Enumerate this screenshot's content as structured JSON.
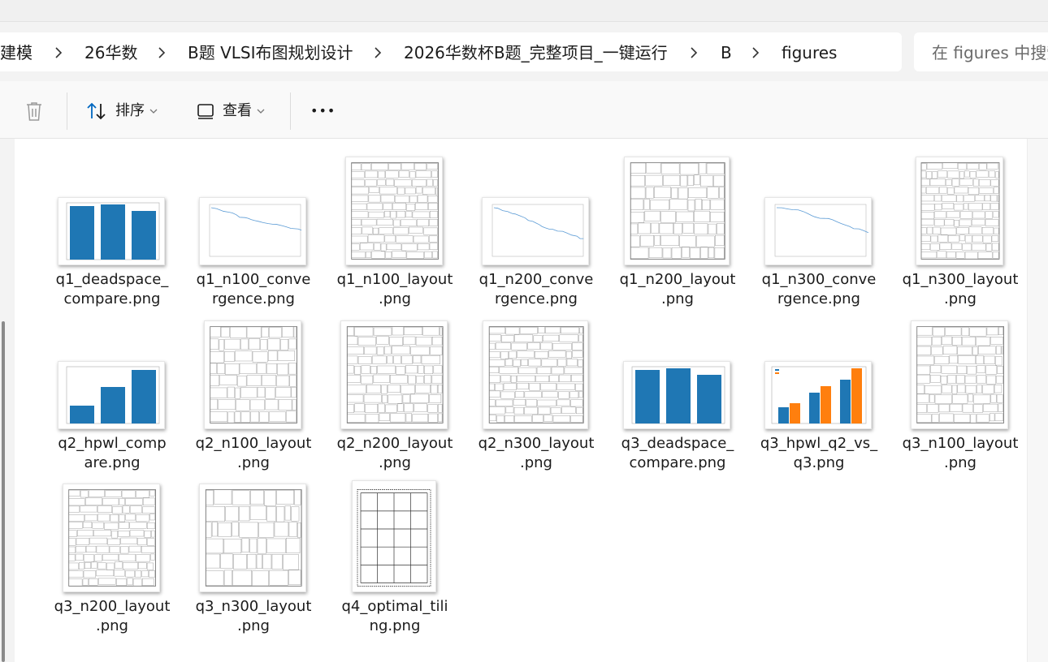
{
  "breadcrumb": [
    "建模",
    "26华数",
    "B题 VLSI布图规划设计",
    "2026华数杯B题_完整项目_一键运行",
    "B",
    "figures"
  ],
  "search": {
    "placeholder": "在 figures 中搜索"
  },
  "toolbar": {
    "delete_icon": "trash-icon",
    "sort_label": "排序",
    "view_label": "查看",
    "more_label": "•••"
  },
  "files": [
    {
      "line1": "q1_deadspace_",
      "line2": "compare.png",
      "kind": "bar3"
    },
    {
      "line1": "q1_n100_conve",
      "line2": "rgence.png",
      "kind": "conv"
    },
    {
      "line1": "q1_n100_layout",
      "line2": ".png",
      "kind": "layout"
    },
    {
      "line1": "q1_n200_conve",
      "line2": "rgence.png",
      "kind": "conv"
    },
    {
      "line1": "q1_n200_layout",
      "line2": ".png",
      "kind": "layout"
    },
    {
      "line1": "q1_n300_conve",
      "line2": "rgence.png",
      "kind": "conv"
    },
    {
      "line1": "q1_n300_layout",
      "line2": ".png",
      "kind": "layout"
    },
    {
      "line1": "q2_hpwl_comp",
      "line2": "are.png",
      "kind": "bar3up"
    },
    {
      "line1": "q2_n100_layout",
      "line2": ".png",
      "kind": "layout"
    },
    {
      "line1": "q2_n200_layout",
      "line2": ".png",
      "kind": "layout"
    },
    {
      "line1": "q2_n300_layout",
      "line2": ".png",
      "kind": "layout"
    },
    {
      "line1": "q3_deadspace_",
      "line2": "compare.png",
      "kind": "bar3"
    },
    {
      "line1": "q3_hpwl_q2_vs_",
      "line2": "q3.png",
      "kind": "bar6"
    },
    {
      "line1": "q3_n100_layout",
      "line2": ".png",
      "kind": "layout"
    },
    {
      "line1": "q3_n200_layout",
      "line2": ".png",
      "kind": "layout"
    },
    {
      "line1": "q3_n300_layout",
      "line2": ".png",
      "kind": "layout"
    },
    {
      "line1": "q4_optimal_tili",
      "line2": "ng.png",
      "kind": "tiling"
    }
  ],
  "colors": {
    "blue": "#1f77b4",
    "orange": "#ff7f0e",
    "accent": "#0067c0"
  }
}
